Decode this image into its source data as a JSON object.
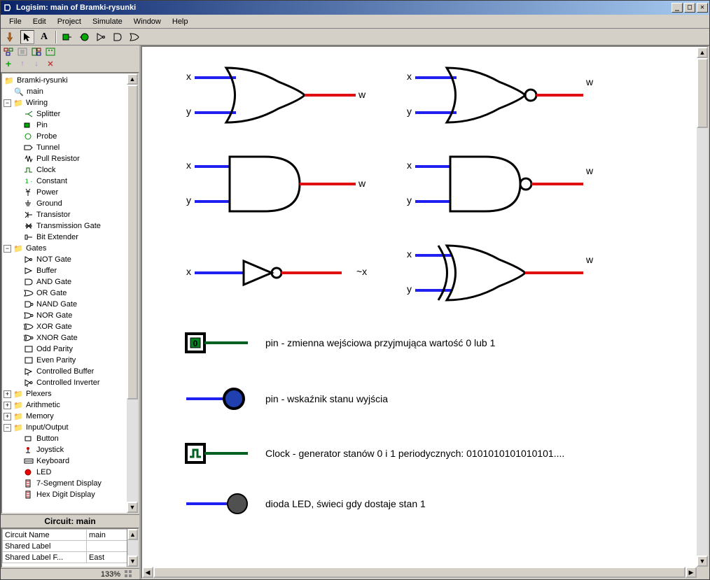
{
  "title": "Logisim: main of Bramki-rysunki",
  "menu": [
    "File",
    "Edit",
    "Project",
    "Simulate",
    "Window",
    "Help"
  ],
  "toolbar": {
    "poke": "Poke",
    "select": "Select",
    "text": "A",
    "pin_in": "Pin",
    "pin_out": "Pin",
    "not": "NOT",
    "and": "AND",
    "or": "OR"
  },
  "sidebar_icons": {
    "add": "+",
    "up": "↑",
    "down": "↓",
    "delete": "✕"
  },
  "tree": {
    "project": "Bramki-rysunki",
    "main": "main",
    "wiring": {
      "label": "Wiring",
      "items": [
        "Splitter",
        "Pin",
        "Probe",
        "Tunnel",
        "Pull Resistor",
        "Clock",
        "Constant",
        "Power",
        "Ground",
        "Transistor",
        "Transmission Gate",
        "Bit Extender"
      ]
    },
    "gates": {
      "label": "Gates",
      "items": [
        "NOT Gate",
        "Buffer",
        "AND Gate",
        "OR Gate",
        "NAND Gate",
        "NOR Gate",
        "XOR Gate",
        "XNOR Gate",
        "Odd Parity",
        "Even Parity",
        "Controlled Buffer",
        "Controlled Inverter"
      ]
    },
    "plexers": "Plexers",
    "arithmetic": "Arithmetic",
    "memory": "Memory",
    "io": {
      "label": "Input/Output",
      "items": [
        "Button",
        "Joystick",
        "Keyboard",
        "LED",
        "7-Segment Display",
        "Hex Digit Display"
      ]
    }
  },
  "props": {
    "header": "Circuit: main",
    "rows": [
      [
        "Circuit Name",
        "main"
      ],
      [
        "Shared Label",
        ""
      ],
      [
        "Shared Label F...",
        "East"
      ]
    ]
  },
  "zoom": "133%",
  "canvas": {
    "gates": {
      "or": {
        "in1": "x",
        "in2": "y",
        "out": "w"
      },
      "nor": {
        "in1": "x",
        "in2": "y",
        "out": "w"
      },
      "and": {
        "in1": "x",
        "in2": "y",
        "out": "w"
      },
      "nand": {
        "in1": "x",
        "in2": "y",
        "out": "w"
      },
      "not": {
        "in": "x",
        "out": "~x"
      },
      "xor": {
        "in1": "x",
        "in2": "y",
        "out": "w"
      }
    },
    "legend": {
      "pin_in": "pin  - zmienna wejściowa przyjmująca wartość 0 lub 1",
      "pin_out": "pin  - wskaźnik stanu wyjścia",
      "clock": "Clock - generator stanów  0 i 1  periodycznych:   0101010101010101....",
      "led": "dioda LED, świeci gdy dostaje stan  1"
    }
  }
}
